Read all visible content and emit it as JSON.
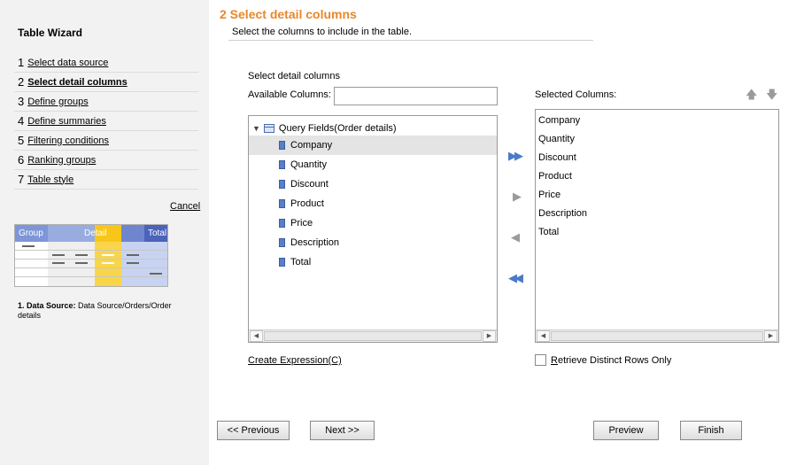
{
  "sidebar": {
    "title": "Table Wizard",
    "steps": [
      {
        "num": "1",
        "label": "Select data source"
      },
      {
        "num": "2",
        "label": "Select detail columns"
      },
      {
        "num": "3",
        "label": "Define groups"
      },
      {
        "num": "4",
        "label": "Define summaries"
      },
      {
        "num": "5",
        "label": "Filtering conditions"
      },
      {
        "num": "6",
        "label": "Ranking groups"
      },
      {
        "num": "7",
        "label": "Table style"
      }
    ],
    "cancel_label": "Cancel",
    "preview": {
      "group": "Group",
      "detail": "Detail",
      "total": "Total"
    },
    "ds_label": "1. Data Source:",
    "ds_value": "Data Source/Orders/Order details"
  },
  "main": {
    "title": "2  Select detail columns",
    "subtitle": "Select the columns to include in the table.",
    "section_label": "Select detail columns",
    "available_label": "Available Columns:",
    "available_value": "",
    "tree_root": "Query Fields(Order details)",
    "fields": [
      "Company",
      "Quantity",
      "Discount",
      "Product",
      "Price",
      "Description",
      "Total"
    ],
    "selected_field": "Company",
    "selected_label": "Selected Columns:",
    "selected_columns": [
      "Company",
      "Quantity",
      "Discount",
      "Product",
      "Price",
      "Description",
      "Total"
    ],
    "create_expression": "Create Expression(C)",
    "distinct_prefix": "R",
    "distinct_rest": "etrieve Distinct Rows Only",
    "distinct_checked": false
  },
  "buttons": {
    "previous": "<< Previous",
    "next": "Next >>",
    "preview": "Preview",
    "finish": "Finish"
  },
  "colors": {
    "accent": "#e8872a",
    "arrow_active": "#4a7ac8",
    "arrow_disabled": "#9a9a9a",
    "preview_header": "#7e96d8",
    "preview_detail": "#f7c619"
  }
}
